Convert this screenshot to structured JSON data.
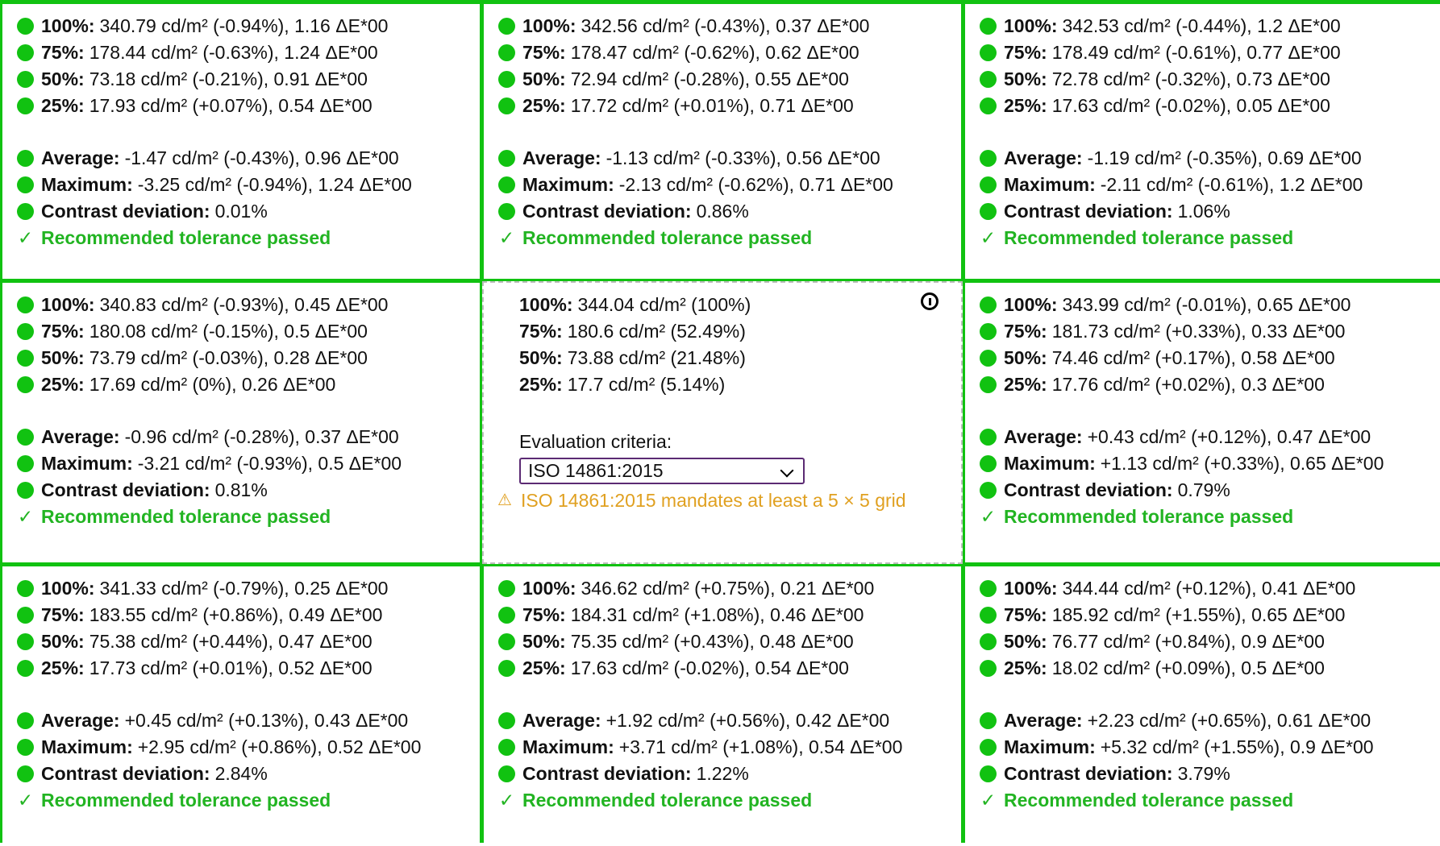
{
  "cells": [
    {
      "lines": [
        {
          "label": "100%:",
          "value": "340.79 cd/m² (-0.94%), 1.16 ΔE*00"
        },
        {
          "label": "75%:",
          "value": "178.44 cd/m² (-0.63%), 1.24 ΔE*00"
        },
        {
          "label": "50%:",
          "value": "73.18 cd/m² (-0.21%), 0.91 ΔE*00"
        },
        {
          "label": "25%:",
          "value": "17.93 cd/m² (+0.07%), 0.54 ΔE*00"
        },
        {
          "label": "Average:",
          "value": "-1.47 cd/m² (-0.43%), 0.96 ΔE*00"
        },
        {
          "label": "Maximum:",
          "value": "-3.25 cd/m² (-0.94%), 1.24 ΔE*00"
        },
        {
          "label": "Contrast deviation:",
          "value": "0.01%"
        }
      ],
      "pass": "Recommended tolerance passed"
    },
    {
      "lines": [
        {
          "label": "100%:",
          "value": "342.56 cd/m² (-0.43%), 0.37 ΔE*00"
        },
        {
          "label": "75%:",
          "value": "178.47 cd/m² (-0.62%), 0.62 ΔE*00"
        },
        {
          "label": "50%:",
          "value": "72.94 cd/m² (-0.28%), 0.55 ΔE*00"
        },
        {
          "label": "25%:",
          "value": "17.72 cd/m² (+0.01%), 0.71 ΔE*00"
        },
        {
          "label": "Average:",
          "value": "-1.13 cd/m² (-0.33%), 0.56 ΔE*00"
        },
        {
          "label": "Maximum:",
          "value": "-2.13 cd/m² (-0.62%), 0.71 ΔE*00"
        },
        {
          "label": "Contrast deviation:",
          "value": "0.86%"
        }
      ],
      "pass": "Recommended tolerance passed"
    },
    {
      "lines": [
        {
          "label": "100%:",
          "value": "342.53 cd/m² (-0.44%), 1.2 ΔE*00"
        },
        {
          "label": "75%:",
          "value": "178.49 cd/m² (-0.61%), 0.77 ΔE*00"
        },
        {
          "label": "50%:",
          "value": "72.78 cd/m² (-0.32%), 0.73 ΔE*00"
        },
        {
          "label": "25%:",
          "value": "17.63 cd/m² (-0.02%), 0.05 ΔE*00"
        },
        {
          "label": "Average:",
          "value": "-1.19 cd/m² (-0.35%), 0.69 ΔE*00"
        },
        {
          "label": "Maximum:",
          "value": "-2.11 cd/m² (-0.61%), 1.2 ΔE*00"
        },
        {
          "label": "Contrast deviation:",
          "value": "1.06%"
        }
      ],
      "pass": "Recommended tolerance passed"
    },
    {
      "lines": [
        {
          "label": "100%:",
          "value": "340.83 cd/m² (-0.93%), 0.45 ΔE*00"
        },
        {
          "label": "75%:",
          "value": "180.08 cd/m² (-0.15%), 0.5 ΔE*00"
        },
        {
          "label": "50%:",
          "value": "73.79 cd/m² (-0.03%), 0.28 ΔE*00"
        },
        {
          "label": "25%:",
          "value": "17.69 cd/m² (0%), 0.26 ΔE*00"
        },
        {
          "label": "Average:",
          "value": "-0.96 cd/m² (-0.28%), 0.37 ΔE*00"
        },
        {
          "label": "Maximum:",
          "value": "-3.21 cd/m² (-0.93%), 0.5 ΔE*00"
        },
        {
          "label": "Contrast deviation:",
          "value": "0.81%"
        }
      ],
      "pass": "Recommended tolerance passed"
    },
    {
      "center": true
    },
    {
      "lines": [
        {
          "label": "100%:",
          "value": "343.99 cd/m² (-0.01%), 0.65 ΔE*00"
        },
        {
          "label": "75%:",
          "value": "181.73 cd/m² (+0.33%), 0.33 ΔE*00"
        },
        {
          "label": "50%:",
          "value": "74.46 cd/m² (+0.17%), 0.58 ΔE*00"
        },
        {
          "label": "25%:",
          "value": "17.76 cd/m² (+0.02%), 0.3 ΔE*00"
        },
        {
          "label": "Average:",
          "value": "+0.43 cd/m² (+0.12%), 0.47 ΔE*00"
        },
        {
          "label": "Maximum:",
          "value": "+1.13 cd/m² (+0.33%), 0.65 ΔE*00"
        },
        {
          "label": "Contrast deviation:",
          "value": "0.79%"
        }
      ],
      "pass": "Recommended tolerance passed"
    },
    {
      "lines": [
        {
          "label": "100%:",
          "value": "341.33 cd/m² (-0.79%), 0.25 ΔE*00"
        },
        {
          "label": "75%:",
          "value": "183.55 cd/m² (+0.86%), 0.49 ΔE*00"
        },
        {
          "label": "50%:",
          "value": "75.38 cd/m² (+0.44%), 0.47 ΔE*00"
        },
        {
          "label": "25%:",
          "value": "17.73 cd/m² (+0.01%), 0.52 ΔE*00"
        },
        {
          "label": "Average:",
          "value": "+0.45 cd/m² (+0.13%), 0.43 ΔE*00"
        },
        {
          "label": "Maximum:",
          "value": "+2.95 cd/m² (+0.86%), 0.52 ΔE*00"
        },
        {
          "label": "Contrast deviation:",
          "value": "2.84%"
        }
      ],
      "pass": "Recommended tolerance passed"
    },
    {
      "lines": [
        {
          "label": "100%:",
          "value": "346.62 cd/m² (+0.75%), 0.21 ΔE*00"
        },
        {
          "label": "75%:",
          "value": "184.31 cd/m² (+1.08%), 0.46 ΔE*00"
        },
        {
          "label": "50%:",
          "value": "75.35 cd/m² (+0.43%), 0.48 ΔE*00"
        },
        {
          "label": "25%:",
          "value": "17.63 cd/m² (-0.02%), 0.54 ΔE*00"
        },
        {
          "label": "Average:",
          "value": "+1.92 cd/m² (+0.56%), 0.42 ΔE*00"
        },
        {
          "label": "Maximum:",
          "value": "+3.71 cd/m² (+1.08%), 0.54 ΔE*00"
        },
        {
          "label": "Contrast deviation:",
          "value": "1.22%"
        }
      ],
      "pass": "Recommended tolerance passed"
    },
    {
      "lines": [
        {
          "label": "100%:",
          "value": "344.44 cd/m² (+0.12%), 0.41 ΔE*00"
        },
        {
          "label": "75%:",
          "value": "185.92 cd/m² (+1.55%), 0.65 ΔE*00"
        },
        {
          "label": "50%:",
          "value": "76.77 cd/m² (+0.84%), 0.9 ΔE*00"
        },
        {
          "label": "25%:",
          "value": "18.02 cd/m² (+0.09%), 0.5 ΔE*00"
        },
        {
          "label": "Average:",
          "value": "+2.23 cd/m² (+0.65%), 0.61 ΔE*00"
        },
        {
          "label": "Maximum:",
          "value": "+5.32 cd/m² (+1.55%), 0.9 ΔE*00"
        },
        {
          "label": "Contrast deviation:",
          "value": "3.79%"
        }
      ],
      "pass": "Recommended tolerance passed"
    }
  ],
  "reference": {
    "lines": [
      {
        "label": "100%:",
        "value": "344.04 cd/m² (100%)"
      },
      {
        "label": "75%:",
        "value": "180.6 cd/m² (52.49%)"
      },
      {
        "label": "50%:",
        "value": "73.88 cd/m² (21.48%)"
      },
      {
        "label": "25%:",
        "value": "17.7 cd/m² (5.14%)"
      }
    ],
    "criteria_label": "Evaluation criteria:",
    "criteria_value": "ISO 14861:2015",
    "warning": "ISO 14861:2015 mandates at least a 5 × 5 grid",
    "info_icon": "info-icon"
  },
  "icons": {
    "pass_check": "✓",
    "warning": "⚠"
  },
  "colors": {
    "pass": "#11c211",
    "warning": "#e0a020",
    "select_border": "#5b2a73"
  }
}
